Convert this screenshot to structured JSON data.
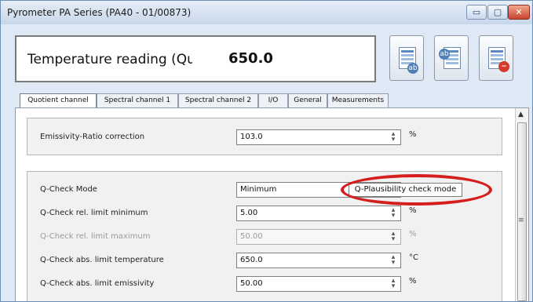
{
  "window": {
    "title": "Pyrometer PA Series (PA40 - 01/00873)",
    "min_label": "▭",
    "max_label": "▢",
    "close_label": "✕"
  },
  "readout": {
    "label": "Temperature reading (Qu",
    "value": "650.0"
  },
  "toolbar": [
    {
      "icon": "spreadsheet-edit-icon",
      "badge": "ab"
    },
    {
      "icon": "spreadsheet-transfer-icon",
      "badge": "ab"
    },
    {
      "icon": "spreadsheet-delete-icon",
      "badge": "−"
    }
  ],
  "tabs": [
    {
      "label": "Quotient channel",
      "active": true
    },
    {
      "label": "Spectral channel 1"
    },
    {
      "label": "Spectral channel 2"
    },
    {
      "label": "I/O"
    },
    {
      "label": "General"
    },
    {
      "label": "Measurements"
    }
  ],
  "emissivity_row": {
    "label": "Emissivity-Ratio correction",
    "value": "103.0",
    "unit": "%"
  },
  "qcheck": {
    "mode": {
      "label": "Q-Check Mode",
      "value": "Minimum"
    },
    "tooltip": "Q-Plausibility check mode",
    "rows": [
      {
        "label": "Q-Check rel. limit minimum",
        "value": "5.00",
        "unit": "%"
      },
      {
        "label": "Q-Check rel. limit maximum",
        "value": "50.00",
        "unit": "%"
      },
      {
        "label": "Q-Check abs. limit temperature",
        "value": "650.0",
        "unit": "°C"
      },
      {
        "label": "Q-Check abs. limit emissivity",
        "value": "50.00",
        "unit": "%"
      }
    ]
  },
  "colors": {
    "callout": "#d51f1f",
    "title_bar": "#c7d7ea",
    "close_button": "#c9452e"
  }
}
